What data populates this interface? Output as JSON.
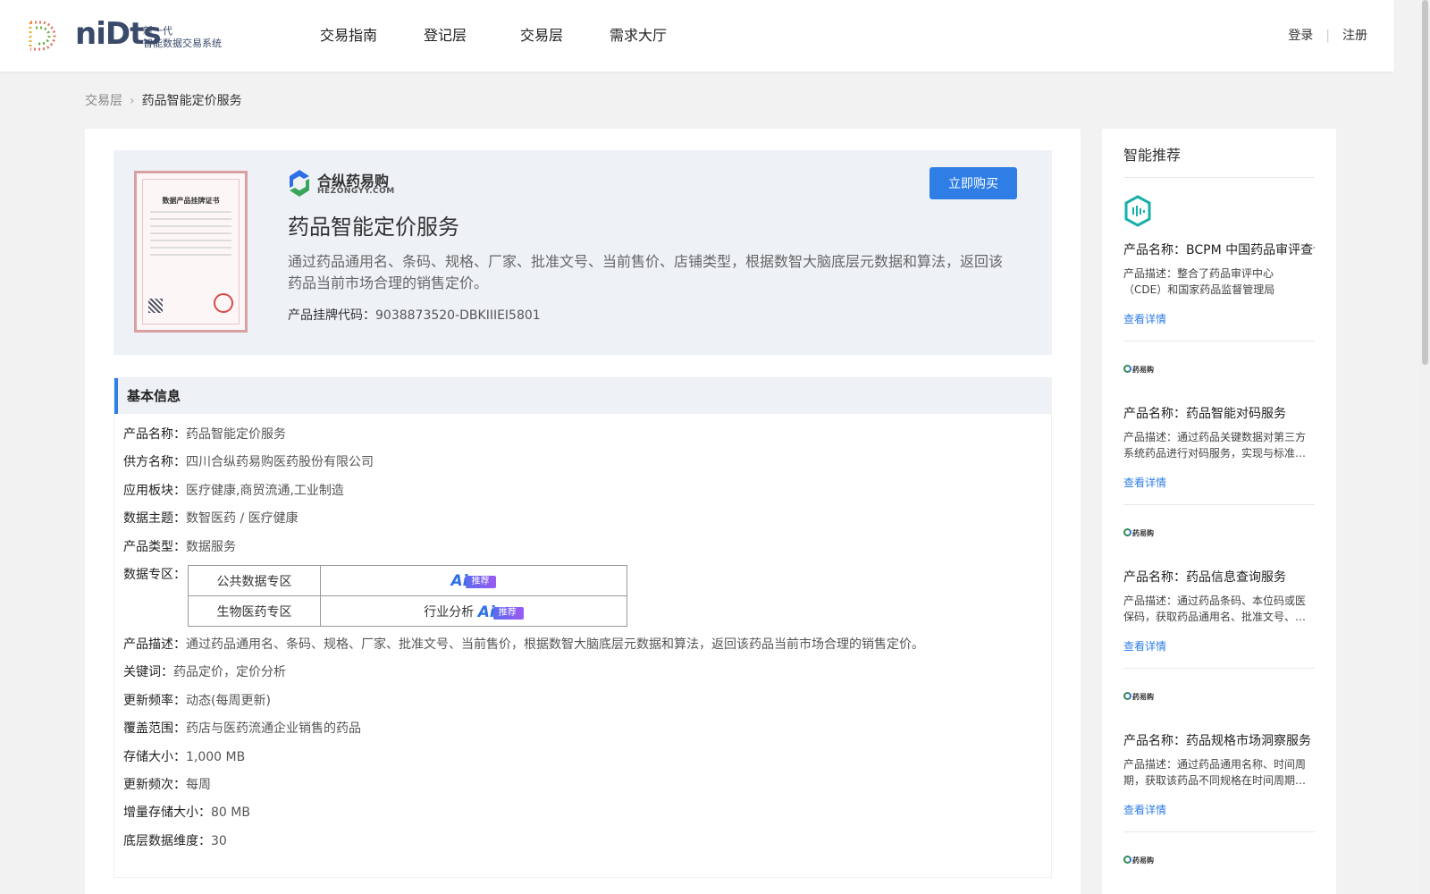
{
  "header": {
    "logo_word": "niDts",
    "logo_sub_1": "新一代",
    "logo_sub_2": "智能数据交易系统",
    "nav": [
      "交易指南",
      "登记层",
      "交易层",
      "需求大厅"
    ],
    "login": "登录",
    "register": "注册"
  },
  "breadcrumb": {
    "parent": "交易层",
    "current": "药品智能定价服务"
  },
  "product": {
    "cert_title": "数据产品挂牌证书",
    "brand_name": "合纵药易购",
    "brand_url": "HEZONGYY.COM",
    "buy_label": "立即购买",
    "title": "药品智能定价服务",
    "description": "通过药品通用名、条码、规格、厂家、批准文号、当前售价、店铺类型，根据数智大脑底层元数据和算法，返回该药品当前市场合理的销售定价。",
    "code_label": "产品挂牌代码：",
    "code_value": "9038873520-DBKIIIEI5801"
  },
  "info": {
    "heading": "基本信息",
    "rows": [
      {
        "k": "产品名称：",
        "v": "药品智能定价服务"
      },
      {
        "k": "供方名称：",
        "v": "四川合纵药易购医药股份有限公司"
      },
      {
        "k": "应用板块：",
        "v": "医疗健康,商贸流通,工业制造"
      },
      {
        "k": "数据主题：",
        "v": "数智医药 / 医疗健康"
      },
      {
        "k": "产品类型：",
        "v": "数据服务"
      }
    ],
    "zone_label": "数据专区：",
    "zones": [
      {
        "name": "公共数据专区",
        "tag": "",
        "ai": "Ai",
        "badge": "推荐"
      },
      {
        "name": "生物医药专区",
        "tag": "行业分析",
        "ai": "Ai",
        "badge": "推荐"
      }
    ],
    "rows2": [
      {
        "k": "产品描述：",
        "v": "通过药品通用名、条码、规格、厂家、批准文号、当前售价，根据数智大脑底层元数据和算法，返回该药品当前市场合理的销售定价。"
      },
      {
        "k": "关键词：",
        "v": "药品定价，定价分析"
      },
      {
        "k": "更新频率：",
        "v": "动态(每周更新)"
      },
      {
        "k": "覆盖范围：",
        "v": "药店与医药流通企业销售的药品"
      },
      {
        "k": "存储大小：",
        "v": "1,000 MB"
      },
      {
        "k": "更新频次：",
        "v": "每周"
      },
      {
        "k": "增量存储大小：",
        "v": "80 MB"
      },
      {
        "k": "底层数据维度：",
        "v": "30"
      }
    ]
  },
  "sidebar": {
    "title": "智能推荐",
    "mini_brand": "药易购",
    "cards": [
      {
        "name": "产品名称：BCPM 中国药品审评查询",
        "desc": "产品描述：整合了药品审评中心（CDE）和国家药品监督管理局（NMPA）等多…",
        "link": "查看详情"
      },
      {
        "name": "产品名称：药品智能对码服务",
        "desc": "产品描述：通过药品关键数据对第三方系统药品进行对码服务，实现与标准…",
        "link": "查看详情"
      },
      {
        "name": "产品名称：药品信息查询服务",
        "desc": "产品描述：通过药品条码、本位码或医保码，获取药品通用名、批准文号、…",
        "link": "查看详情"
      },
      {
        "name": "产品名称：药品规格市场洞察服务",
        "desc": "产品描述：通过药品通用名称、时间周期，获取该药品不同规格在时间周期…",
        "link": "查看详情"
      }
    ]
  },
  "colors": {
    "accent": "#2f7ee6",
    "page_bg": "#f2f2f2"
  }
}
